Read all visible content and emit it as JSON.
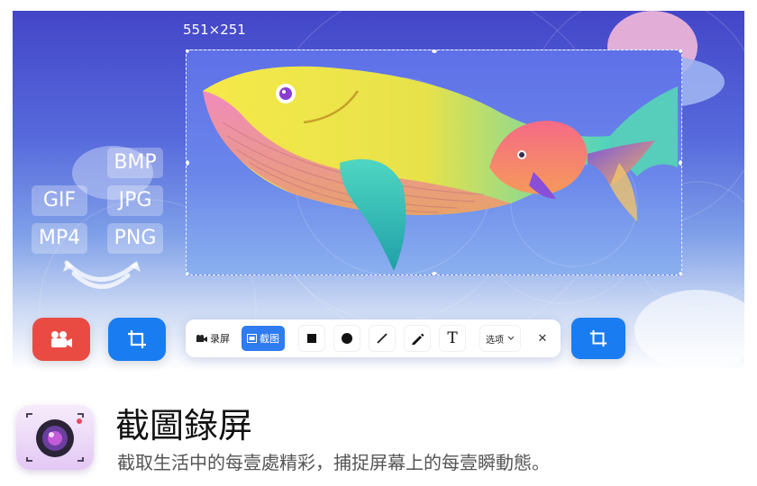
{
  "hero": {
    "selection_size": "551×251",
    "formats": [
      "BMP",
      "GIF",
      "JPG",
      "MP4",
      "PNG"
    ]
  },
  "toolbar": {
    "record_label": "录屏",
    "capture_label": "截图",
    "tools": [
      "rectangle-icon",
      "ellipse-icon",
      "line-icon",
      "pen-icon",
      "text-icon"
    ],
    "text_tool_glyph": "T",
    "options_label": "选项",
    "close_glyph": "✕"
  },
  "app": {
    "title": "截圖錄屏",
    "subtitle": "截取生活中的每壹處精彩，捕捉屏幕上的每壹瞬動態。"
  },
  "colors": {
    "record_button": "#e94b43",
    "capture_button": "#1a7cf1",
    "accent": "#2f7bf0"
  }
}
